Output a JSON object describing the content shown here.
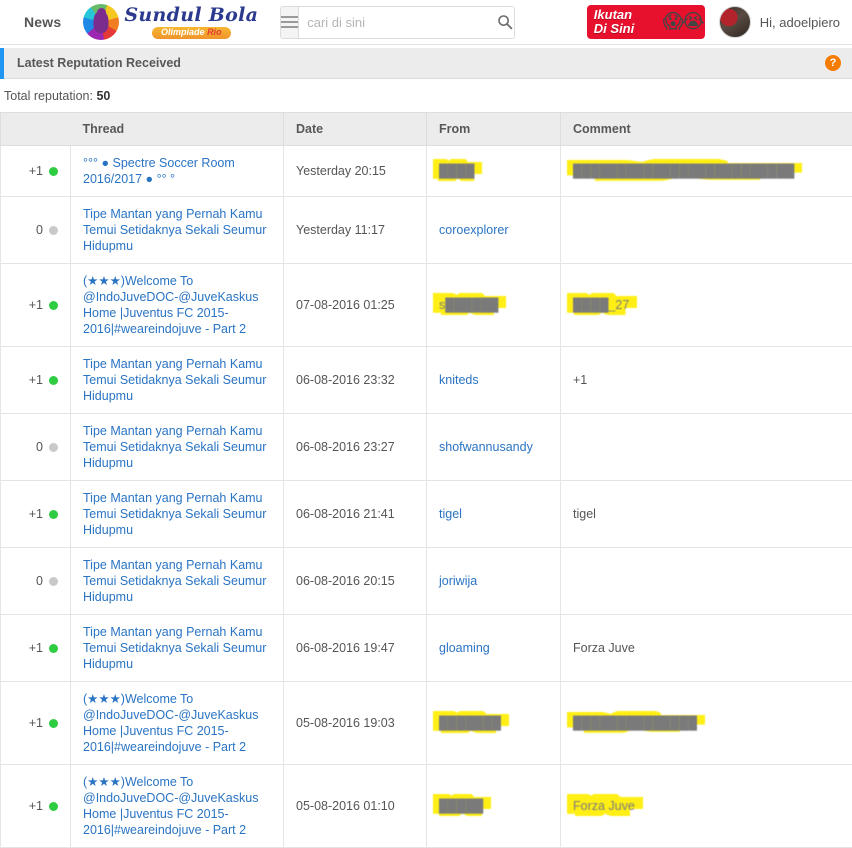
{
  "header": {
    "news_label": "News",
    "logo": {
      "name": "Sundul Bola",
      "badge_first": "Olimpiade",
      "badge_second": "Rio"
    },
    "search": {
      "placeholder": "cari di sini",
      "value": "",
      "menu_icon": "hamburger-menu-icon",
      "search_icon": "search-icon"
    },
    "promo": {
      "line1": "Ikutan",
      "line2": "Di Sini",
      "chars": "😱😭"
    },
    "user": {
      "greeting": "Hi, adoelpiero",
      "avatar_icon": "user-avatar"
    }
  },
  "panel": {
    "title": "Latest Reputation Received",
    "help_icon": "?",
    "accent_color": "#2196f3",
    "total_reputation_label": "Total reputation:",
    "total_reputation_value": "50"
  },
  "table": {
    "columns": [
      "Thread",
      "Date",
      "From",
      "Comment"
    ],
    "rows": [
      {
        "score": "+1",
        "score_state": "pos",
        "thread": "°°° ● Spectre Soccer Room 2016/2017 ● °° °",
        "date": "Yesterday 20:15",
        "from": "████",
        "from_redacted": true,
        "comment": "█████████████████████████",
        "comment_redacted": true
      },
      {
        "score": "0",
        "score_state": "zero",
        "thread": "Tipe Mantan yang Pernah Kamu Temui Setidaknya Sekali Seumur Hidupmu",
        "date": "Yesterday 11:17",
        "from": "coroexplorer",
        "from_redacted": false,
        "comment": "",
        "comment_redacted": false
      },
      {
        "score": "+1",
        "score_state": "pos",
        "thread": "(★★★)Welcome To @IndoJuveDOC-@JuveKaskus Home |Juventus FC 2015-2016|#weareindojuve - Part 2",
        "date": "07-08-2016 01:25",
        "from": "s██████",
        "from_redacted": true,
        "comment": "████_27",
        "comment_redacted": true
      },
      {
        "score": "+1",
        "score_state": "pos",
        "thread": "Tipe Mantan yang Pernah Kamu Temui Setidaknya Sekali Seumur Hidupmu",
        "date": "06-08-2016 23:32",
        "from": "kniteds",
        "from_redacted": false,
        "comment": "+1",
        "comment_redacted": false
      },
      {
        "score": "0",
        "score_state": "zero",
        "thread": "Tipe Mantan yang Pernah Kamu Temui Setidaknya Sekali Seumur Hidupmu",
        "date": "06-08-2016 23:27",
        "from": "shofwannusandy",
        "from_redacted": false,
        "comment": "",
        "comment_redacted": false
      },
      {
        "score": "+1",
        "score_state": "pos",
        "thread": "Tipe Mantan yang Pernah Kamu Temui Setidaknya Sekali Seumur Hidupmu",
        "date": "06-08-2016 21:41",
        "from": "tigel",
        "from_redacted": false,
        "comment": "tigel",
        "comment_redacted": false
      },
      {
        "score": "0",
        "score_state": "zero",
        "thread": "Tipe Mantan yang Pernah Kamu Temui Setidaknya Sekali Seumur Hidupmu",
        "date": "06-08-2016 20:15",
        "from": "joriwija",
        "from_redacted": false,
        "comment": "",
        "comment_redacted": false
      },
      {
        "score": "+1",
        "score_state": "pos",
        "thread": "Tipe Mantan yang Pernah Kamu Temui Setidaknya Sekali Seumur Hidupmu",
        "date": "06-08-2016 19:47",
        "from": "gloaming",
        "from_redacted": false,
        "comment": "Forza Juve",
        "comment_redacted": false
      },
      {
        "score": "+1",
        "score_state": "pos",
        "thread": "(★★★)Welcome To @IndoJuveDOC-@JuveKaskus Home |Juventus FC 2015-2016|#weareindojuve - Part 2",
        "date": "05-08-2016 19:03",
        "from": "███████",
        "from_redacted": true,
        "comment": "██████████████",
        "comment_redacted": true
      },
      {
        "score": "+1",
        "score_state": "pos",
        "thread": "(★★★)Welcome To @IndoJuveDOC-@JuveKaskus Home |Juventus FC 2015-2016|#weareindojuve - Part 2",
        "date": "05-08-2016 01:10",
        "from": "█████",
        "from_redacted": true,
        "comment": "Forza Juve",
        "comment_redacted": true
      }
    ]
  }
}
